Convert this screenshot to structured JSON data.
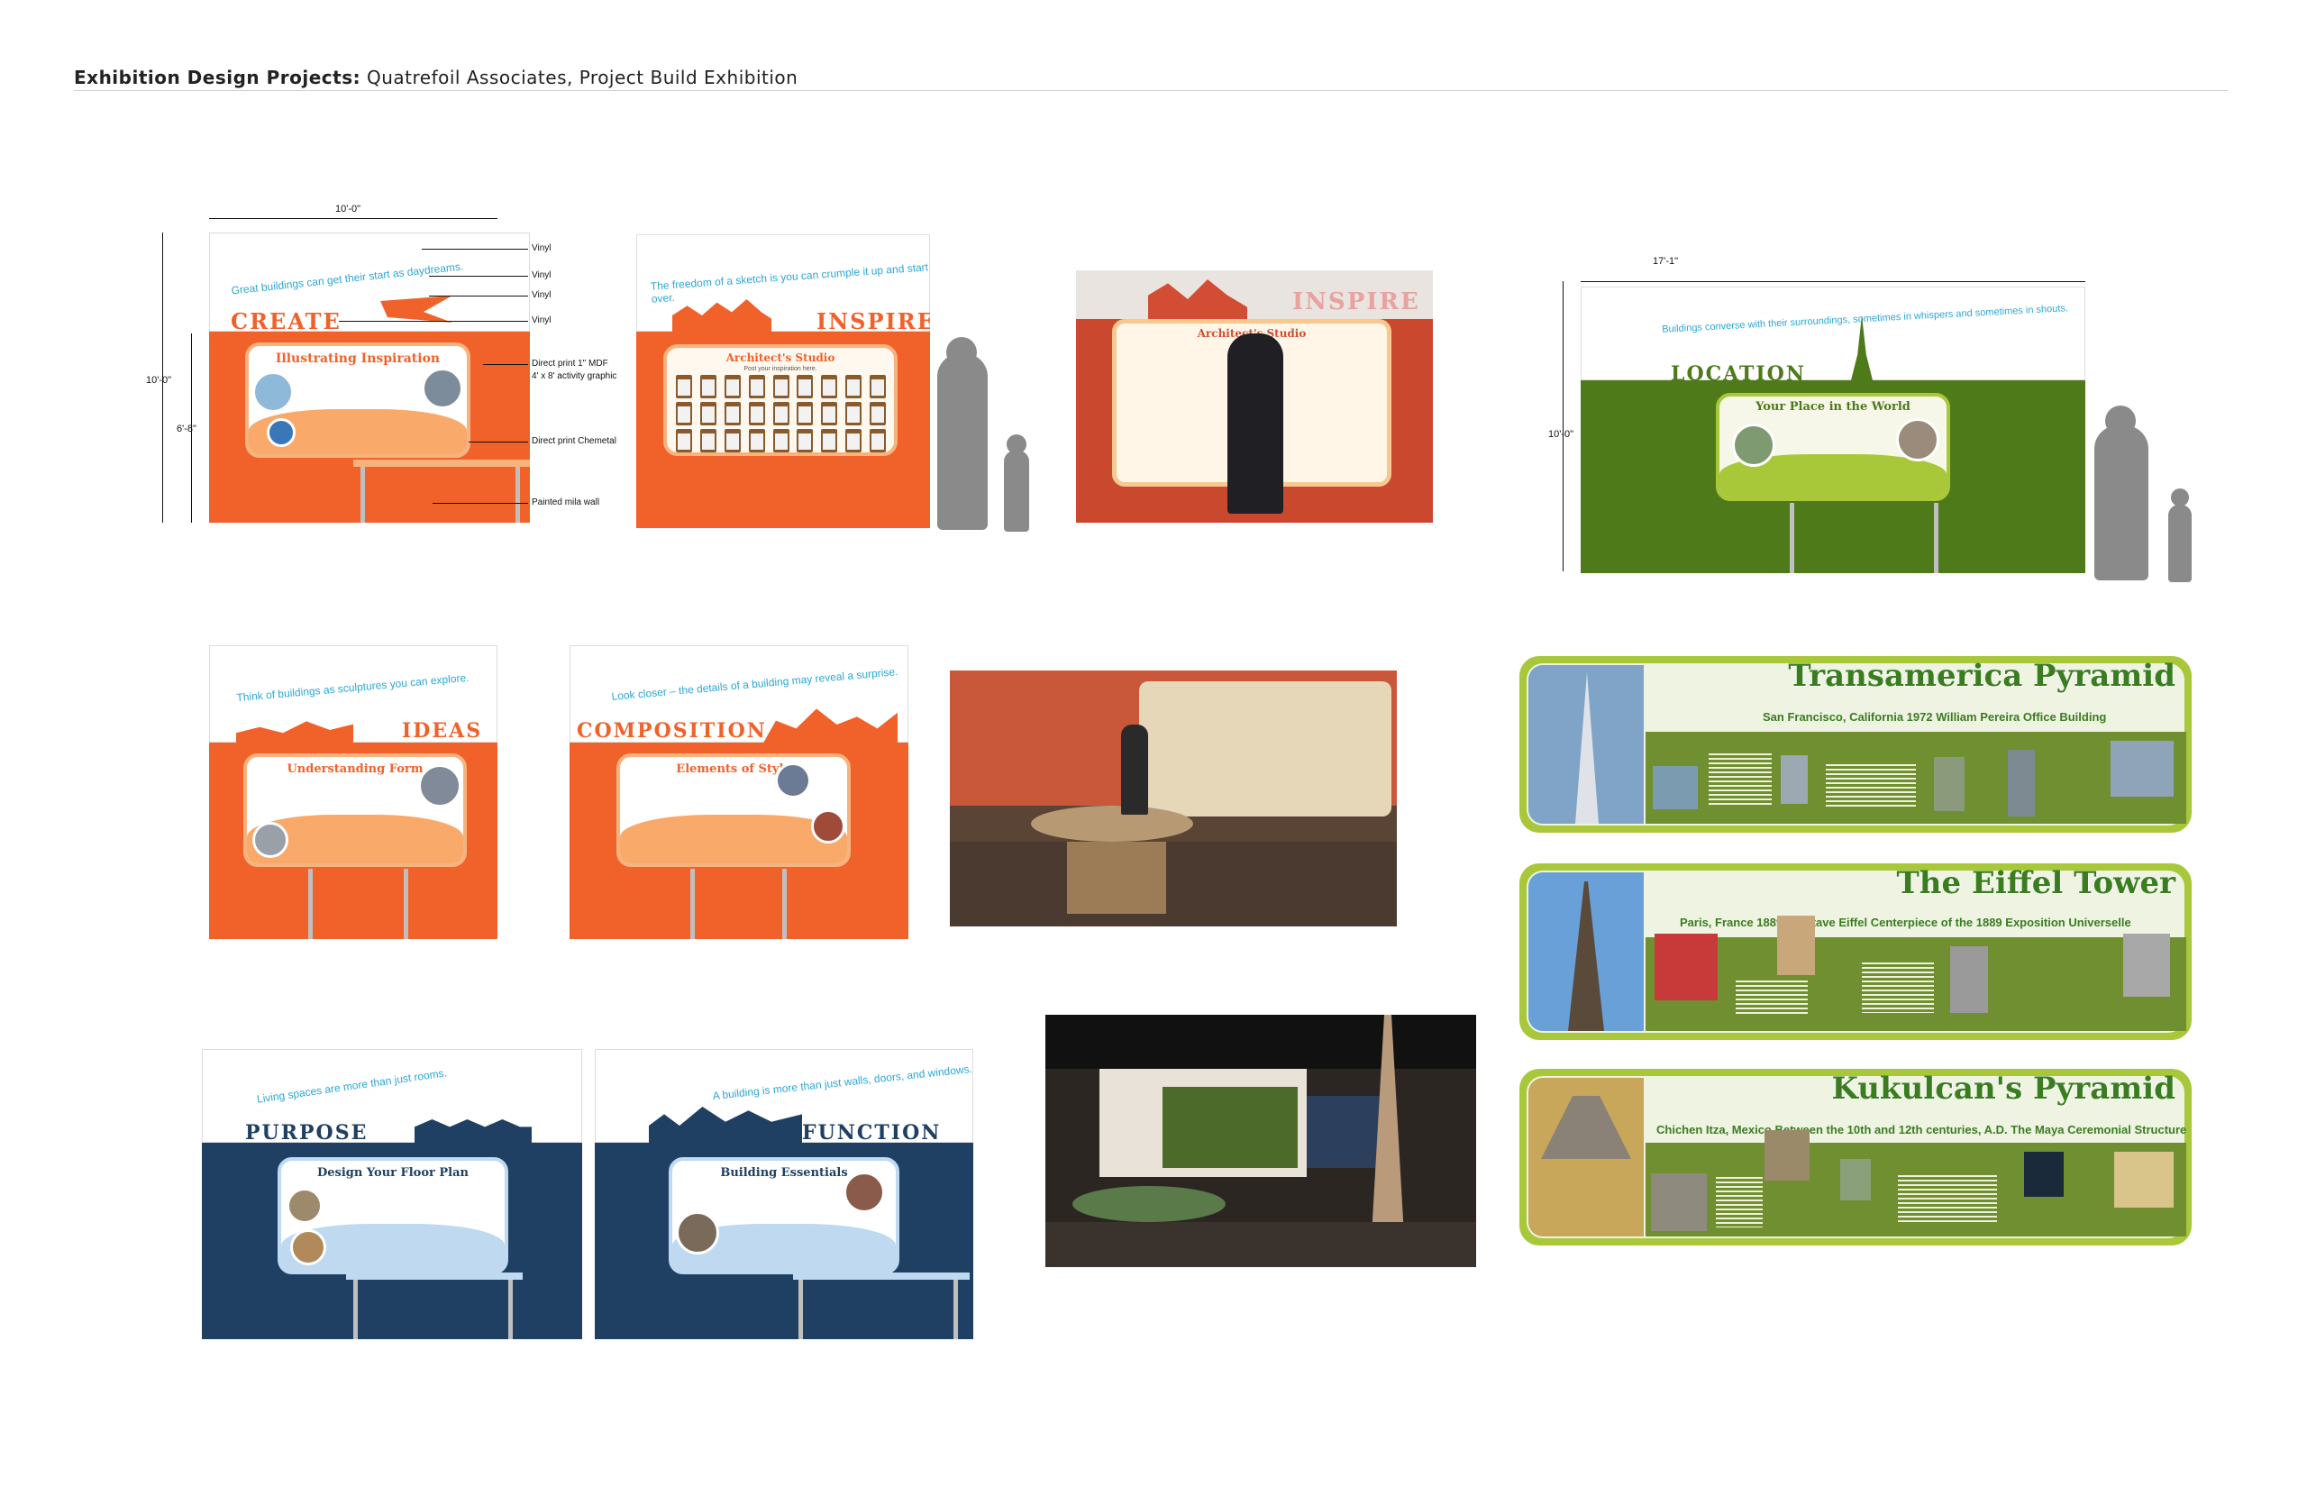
{
  "header": {
    "bold": "Exhibition Design Projects:",
    "rest": " Quatrefoil Associates, Project Build Exhibition"
  },
  "create": {
    "width_dim": "10'-0\"",
    "height_dim": "10'-0\"",
    "sub_dim": "6'-8\"",
    "label": "CREATE",
    "tagline": "Great buildings can get their start as daydreams.",
    "board_title": "Illustrating Inspiration",
    "notes": [
      "Vinyl",
      "Vinyl",
      "Vinyl",
      "Vinyl",
      "Direct print 1\" MDF",
      "4' x 8' activity graphic",
      "Direct print Chemetal",
      "Painted mila wall"
    ]
  },
  "inspire": {
    "label": "INSPIRE",
    "tagline": "The freedom of a sketch is you can crumple it up and start over.",
    "board_title": "Architect's Studio",
    "board_sub": "Post your inspiration here."
  },
  "inspire_photo": {
    "label": "INSPIRE",
    "board_title": "Architect's Studio"
  },
  "location": {
    "width_dim": "17'-1\"",
    "height_dim": "10'-0\"",
    "label": "LOCATION",
    "tagline": "Buildings converse with their surroundings, sometimes in whispers and sometimes in shouts.",
    "board_title": "Your Place in the World"
  },
  "ideas": {
    "label": "IDEAS",
    "tagline": "Think of buildings as sculptures you can explore.",
    "board_title": "Understanding Form"
  },
  "composition": {
    "label": "COMPOSITION",
    "tagline": "Look closer – the details of a building may reveal a surprise.",
    "board_title": "Elements of Style"
  },
  "purpose": {
    "label": "PURPOSE",
    "tagline": "Living spaces are more than just rooms.",
    "board_title": "Design Your Floor Plan"
  },
  "function": {
    "label": "FUNCTION",
    "tagline": "A building is more than just walls, doors, and windows.",
    "board_title": "Building Essentials"
  },
  "banners": [
    {
      "title": "Transamerica Pyramid",
      "subtitle": "San Francisco, California 1972 William Pereira Office Building"
    },
    {
      "title": "The Eiffel Tower",
      "subtitle": "Paris, France 1889, Gustave Eiffel Centerpiece of the 1889 Exposition Universelle"
    },
    {
      "title": "Kukulcan's Pyramid",
      "subtitle": "Chichen Itza, Mexico Between the 10th and 12th centuries, A.D. The Maya Ceremonial Structure"
    }
  ],
  "colors": {
    "orange": "#f0622a",
    "green": "#4e7a1a",
    "navy": "#1f3f63",
    "cyan": "#2aa7d6",
    "lime": "#a8c83a"
  }
}
